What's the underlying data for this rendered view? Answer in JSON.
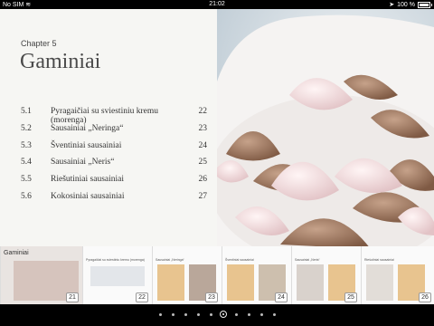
{
  "status_bar": {
    "carrier": "No SIM",
    "carrier_icon": "wifi-icon",
    "time": "21:02",
    "location_icon": "location-arrow-icon",
    "battery": "100 %"
  },
  "chapter": {
    "label": "Chapter 5",
    "title": "Gaminiai"
  },
  "toc": [
    {
      "num": "5.1",
      "text": "Pyragaičiai su sviestiniu kremu (morenga)",
      "page": "22"
    },
    {
      "num": "5.2",
      "text": "Sausainiai „Neringa“",
      "page": "23"
    },
    {
      "num": "5.3",
      "text": "Šventiniai sausainiai",
      "page": "24"
    },
    {
      "num": "5.4",
      "text": "Sausainiai „Neris“",
      "page": "25"
    },
    {
      "num": "5.5",
      "text": "Riešutiniai sausainiai",
      "page": "26"
    },
    {
      "num": "5.6",
      "text": "Kokosiniai sausainiai",
      "page": "27"
    }
  ],
  "thumbnails": [
    {
      "title": "Gaminiai",
      "page": "21"
    },
    {
      "title": "Pyragaičiai su sviestiniu kremu (morenga)",
      "page": "22"
    },
    {
      "title": "Sausainiai „Neringa“",
      "page": "23"
    },
    {
      "title": "Šventiniai sausainiai",
      "page": "24"
    },
    {
      "title": "Sausainiai „Neris“",
      "page": "25"
    },
    {
      "title": "Riešutiniai sausainiai",
      "page": "26"
    }
  ],
  "page_indicator": {
    "count": 10,
    "active": 5
  }
}
